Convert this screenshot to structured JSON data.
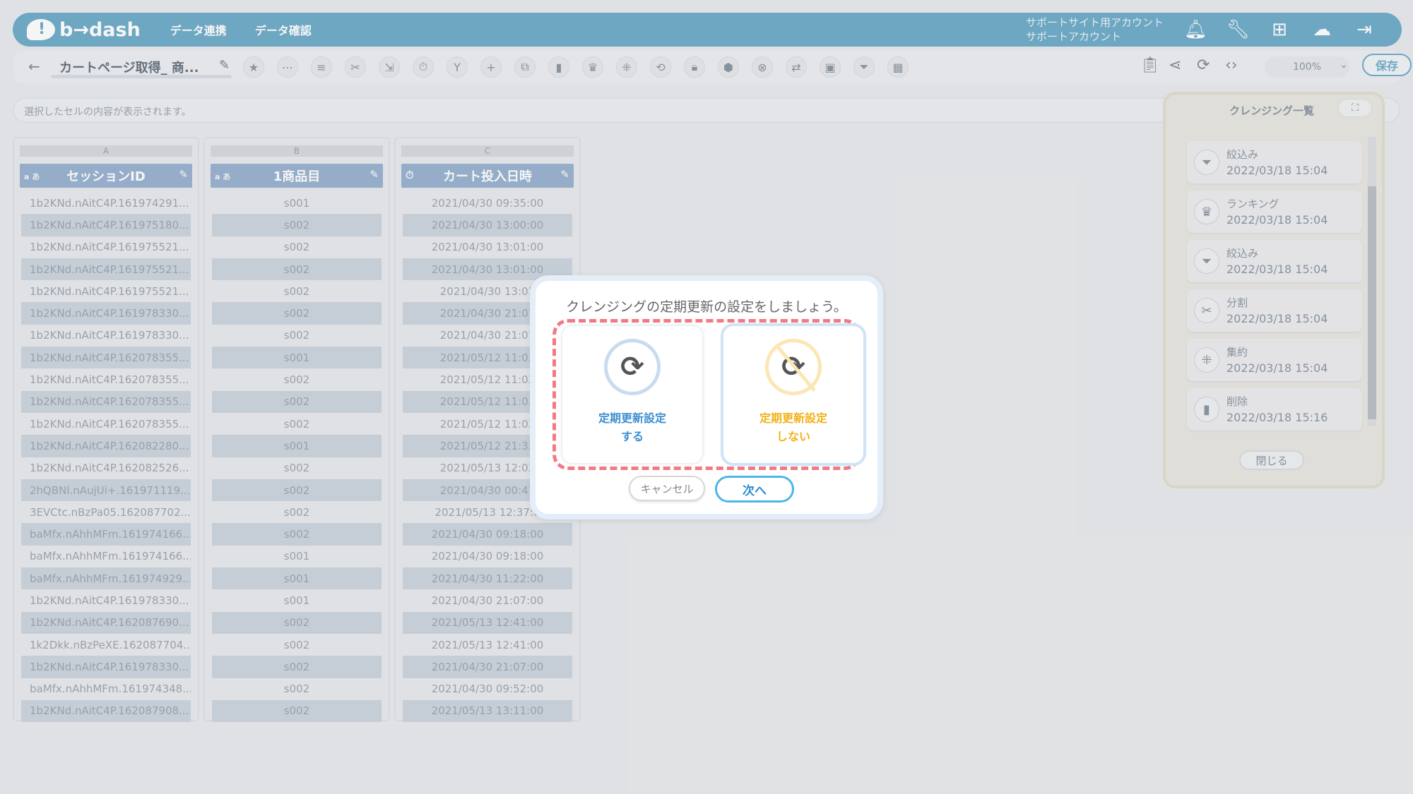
{
  "header": {
    "logo": "b→dash",
    "nav": [
      "データ連携",
      "データ確認"
    ],
    "account_line1": "サポートサイト用アカウント",
    "account_line2": "サポートアカウント",
    "icons": [
      "bell-icon",
      "wrench-icon",
      "grid-icon",
      "chat-icon",
      "logout-icon"
    ],
    "accent": "#5aa0c0"
  },
  "toolbar": {
    "back": "←",
    "title": "カートページ取得_ 商...",
    "zoom": "100%",
    "save_label": "保存"
  },
  "cellbar": {
    "placeholder": "選択したセルの内容が表示されます。"
  },
  "columns": [
    {
      "letter": "A",
      "name": "セッションID",
      "type": "a",
      "cells": [
        "1b2KNd.nAitC4P.161974291...",
        "1b2KNd.nAitC4P.161975180...",
        "1b2KNd.nAitC4P.161975521...",
        "1b2KNd.nAitC4P.161975521...",
        "1b2KNd.nAitC4P.161975521...",
        "1b2KNd.nAitC4P.161978330...",
        "1b2KNd.nAitC4P.161978330...",
        "1b2KNd.nAitC4P.162078355...",
        "1b2KNd.nAitC4P.162078355...",
        "1b2KNd.nAitC4P.162078355...",
        "1b2KNd.nAitC4P.162078355...",
        "1b2KNd.nAitC4P.162082280...",
        "1b2KNd.nAitC4P.162082526...",
        "2hQBNl.nAujUi+.161971119...",
        "3EVCtc.nBzPa05.162087702...",
        "baMfx.nAhhMFm.161974166...",
        "baMfx.nAhhMFm.161974166...",
        "baMfx.nAhhMFm.161974929...",
        "1b2KNd.nAitC4P.161978330...",
        "1b2KNd.nAitC4P.162087690...",
        "1k2Dkk.nBzPeXE.162087704...",
        "1b2KNd.nAitC4P.161978330...",
        "baMfx.nAhhMFm.161974348...",
        "1b2KNd.nAitC4P.162087908..."
      ]
    },
    {
      "letter": "B",
      "name": "1商品目",
      "type": "a",
      "cells": [
        "s001",
        "s002",
        "s002",
        "s002",
        "s002",
        "s002",
        "s002",
        "s001",
        "s002",
        "s002",
        "s002",
        "s001",
        "s002",
        "s002",
        "s002",
        "s002",
        "s001",
        "s001",
        "s001",
        "s002",
        "s002",
        "s002",
        "s002",
        "s002"
      ]
    },
    {
      "letter": "C",
      "name": "カート投入日時",
      "type": "time",
      "cells": [
        "2021/04/30 09:35:00",
        "2021/04/30 13:00:00",
        "2021/04/30 13:01:00",
        "2021/04/30 13:01:00",
        "2021/04/30 13:01",
        "2021/04/30 21:07",
        "2021/04/30 21:07",
        "2021/05/12 11:03",
        "2021/05/12 11:03",
        "2021/05/12 11:03",
        "2021/05/12 11:03",
        "2021/05/12 21:33",
        "2021/05/13 12:03",
        "2021/04/30 00:47",
        "2021/05/13 12:37:0",
        "2021/04/30 09:18:00",
        "2021/04/30 09:18:00",
        "2021/04/30 11:22:00",
        "2021/04/30 21:07:00",
        "2021/05/13 12:41:00",
        "2021/05/13 12:41:00",
        "2021/04/30 21:07:00",
        "2021/04/30 09:52:00",
        "2021/05/13 13:11:00"
      ]
    }
  ],
  "panel": {
    "title": "クレンジング一覧",
    "expand": "⛶",
    "steps": [
      {
        "name": "絞込み",
        "date": "2022/03/18 15:04",
        "icon": "filter-icon"
      },
      {
        "name": "ランキング",
        "date": "2022/03/18 15:04",
        "icon": "crown-icon"
      },
      {
        "name": "絞込み",
        "date": "2022/03/18 15:04",
        "icon": "filter-icon"
      },
      {
        "name": "分割",
        "date": "2022/03/18 15:04",
        "icon": "scissors-icon"
      },
      {
        "name": "集約",
        "date": "2022/03/18 15:04",
        "icon": "aggregate-icon"
      },
      {
        "name": "削除",
        "date": "2022/03/18 15:16",
        "icon": "trash-icon"
      }
    ],
    "close_label": "閉じる"
  },
  "modal": {
    "message": "クレンジングの定期更新の設定をしましょう。",
    "option_yes_line1": "定期更新設定",
    "option_yes_line2": "する",
    "option_no_line1": "定期更新設定",
    "option_no_line2": "しない",
    "cancel_label": "キャンセル",
    "next_label": "次へ",
    "highlight_color": "#f07b85"
  }
}
